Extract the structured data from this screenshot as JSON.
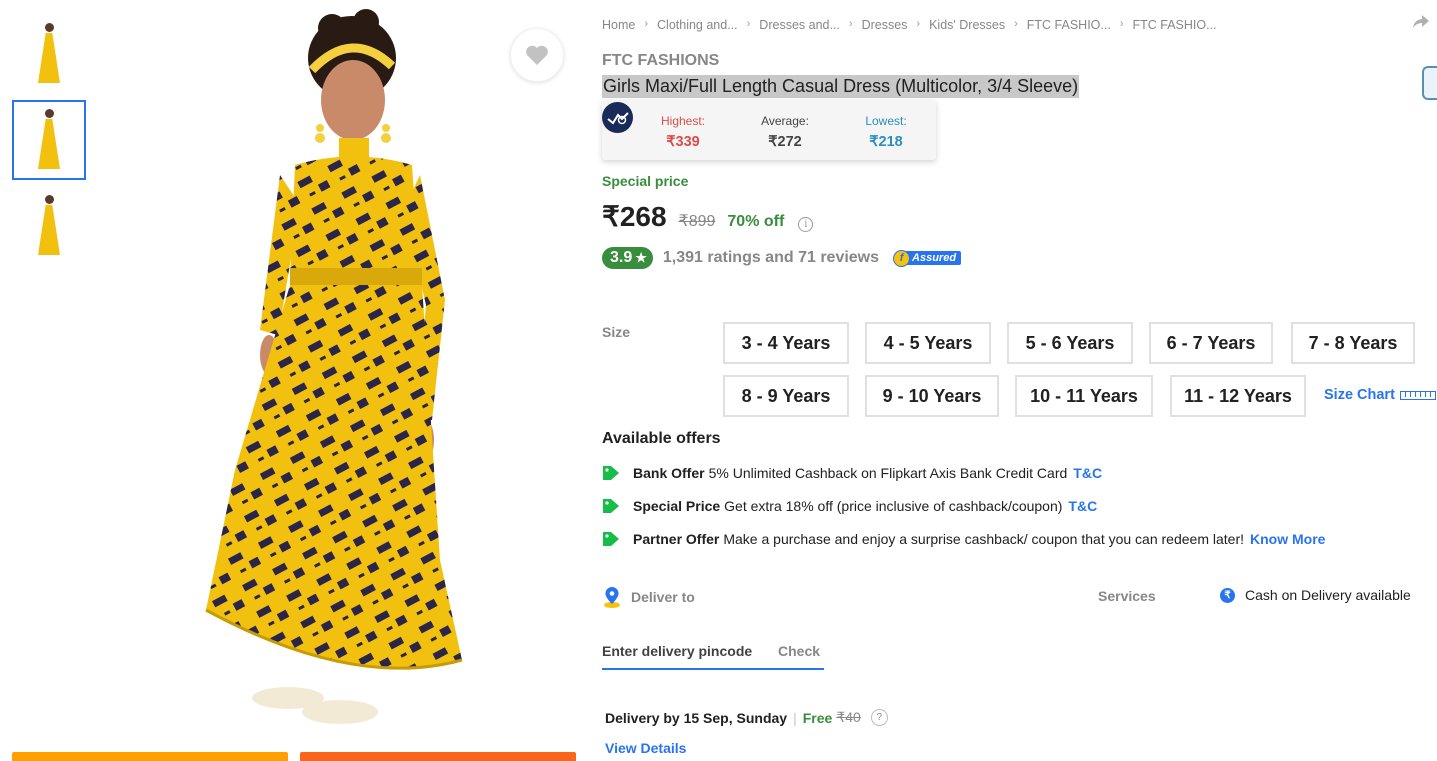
{
  "breadcrumb": [
    "Home",
    "Clothing and...",
    "Dresses and...",
    "Dresses",
    "Kids' Dresses",
    "FTC FASHIO...",
    "FTC FASHIO..."
  ],
  "product": {
    "brand": "FTC FASHIONS",
    "title": "Girls Maxi/Full Length Casual Dress  (Multicolor, 3/4 Sleeve)"
  },
  "price_tracker": {
    "highest_label": "Highest:",
    "highest_value": "₹339",
    "average_label": "Average:",
    "average_value": "₹272",
    "lowest_label": "Lowest:",
    "lowest_value": "₹218"
  },
  "pricing": {
    "special_label": "Special price",
    "price": "₹268",
    "mrp": "₹899",
    "discount": "70% off",
    "info_glyph": "i"
  },
  "rating": {
    "score": "3.9",
    "star": "★",
    "summary": "1,391 ratings and 71 reviews",
    "assured_word": "Assured",
    "assured_letter": "f"
  },
  "size": {
    "label": "Size",
    "options": [
      "3 - 4 Years",
      "4 - 5 Years",
      "5 - 6 Years",
      "6 - 7 Years",
      "7 - 8 Years",
      "8 - 9 Years",
      "9 - 10 Years",
      "10 - 11 Years",
      "11 - 12 Years"
    ],
    "chart_link": "Size Chart"
  },
  "offers": {
    "title": "Available offers",
    "items": [
      {
        "kind": "Bank Offer",
        "desc": "5% Unlimited Cashback on Flipkart Axis Bank Credit Card",
        "link": "T&C"
      },
      {
        "kind": "Special Price",
        "desc": "Get extra 18% off (price inclusive of cashback/coupon)",
        "link": "T&C"
      },
      {
        "kind": "Partner Offer",
        "desc": "Make a purchase and enjoy a surprise cashback/ coupon that you can redeem later!",
        "link": "Know More"
      }
    ]
  },
  "delivery": {
    "deliver_label": "Deliver to",
    "services_label": "Services",
    "cod_text": "Cash on Delivery available",
    "cod_glyph": "₹",
    "pincode_placeholder": "Enter delivery pincode",
    "check_label": "Check",
    "delivery_by": "Delivery by 15 Sep, Sunday",
    "pipe": "|",
    "free_label": "Free",
    "fee": "₹40",
    "help_glyph": "?",
    "view_details": "View Details"
  },
  "icons": {
    "wishlist": "heart-icon",
    "share": "share-icon",
    "offer_tag": "tag-icon",
    "location": "location-pin-icon"
  },
  "colors": {
    "brand_blue": "#2874f0",
    "green": "#388e3c",
    "dress_yellow": "#f2c10f",
    "add_to_cart": "#ff9f00",
    "buy_now": "#fb641b"
  }
}
